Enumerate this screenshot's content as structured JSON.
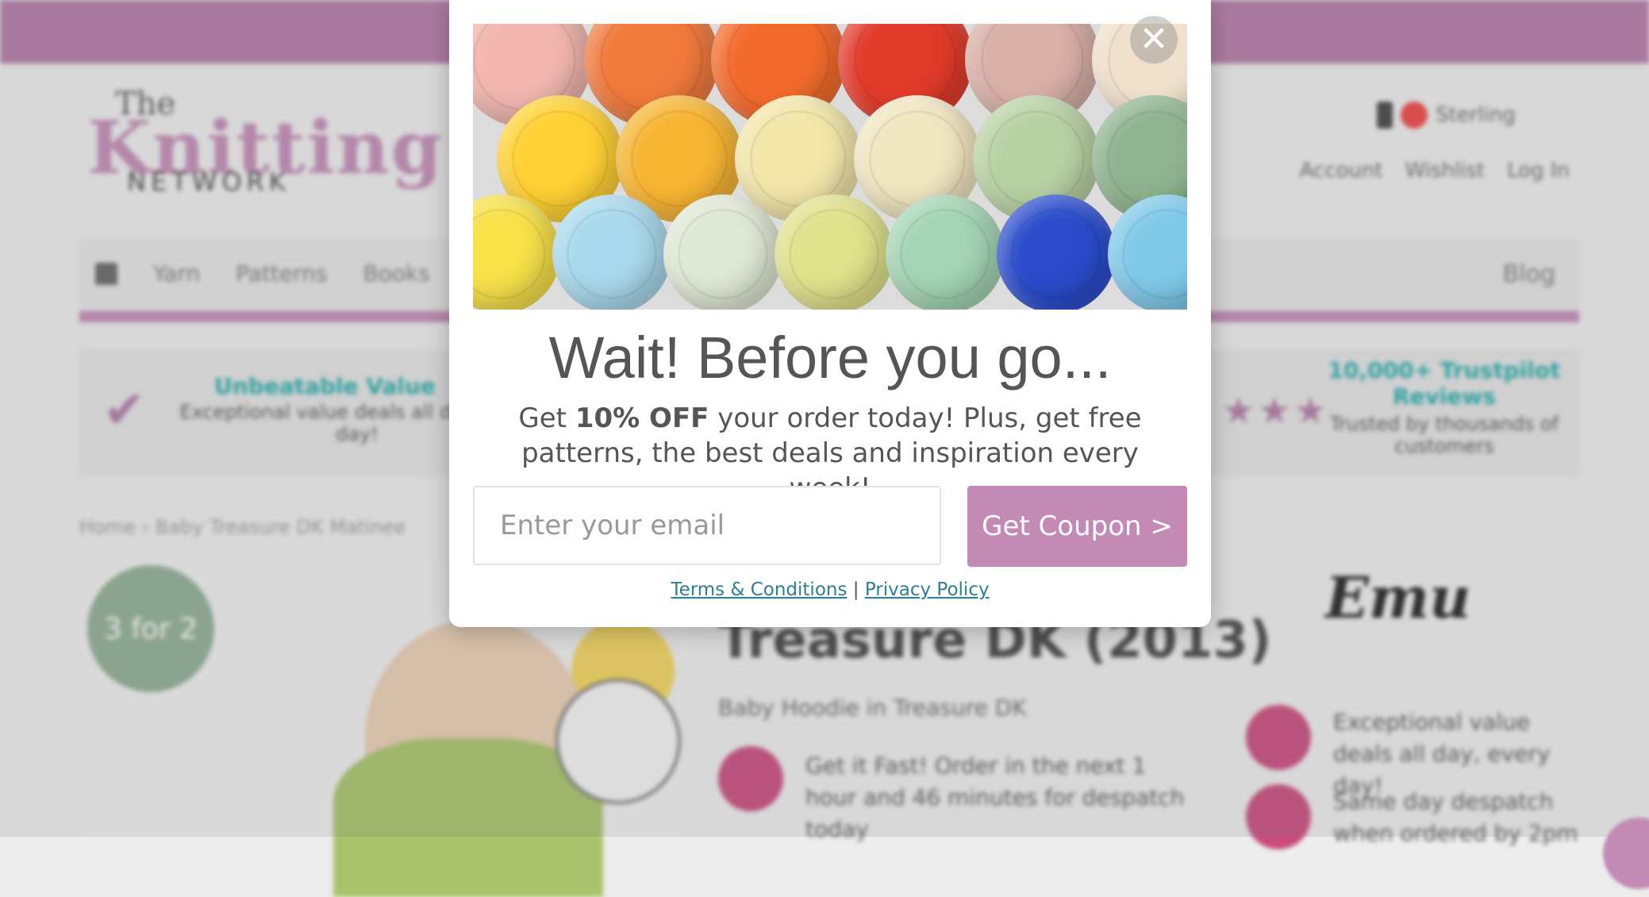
{
  "background_page": {
    "logo": {
      "the": "The",
      "main": "Knitting",
      "sub": "NETWORK"
    },
    "currency_label": "Sterling",
    "account_links": [
      "Account",
      "Wishlist",
      "Log In"
    ],
    "nav_items": [
      "Yarn",
      "Patterns",
      "Books"
    ],
    "nav_right": "Blog",
    "usp_left": {
      "title": "Unbeatable Value",
      "text": "Exceptional value deals all day every day!"
    },
    "usp_right": {
      "title": "10,000+ Trustpilot Reviews",
      "text": "Trusted by thousands of customers"
    },
    "breadcrumb": "Home › Baby Treasure DK Matinee",
    "product_badge": "3 for 2",
    "product_title": "Treasure DK (2013)",
    "product_subtitle": "Baby Hoodie in Treasure DK",
    "dispatch_text": "Get it Fast! Order in the next 1 hour and 46 minutes for despatch today",
    "brand_logo": "Emu",
    "side_usp_1": "Exceptional value deals all day, every day!",
    "side_usp_2": "Same day despatch when ordered by 2pm"
  },
  "modal": {
    "close_label": "✕",
    "headline": "Wait! Before you go...",
    "subtext_prefix": "Get ",
    "subtext_bold": "10% OFF",
    "subtext_suffix": " your order today! Plus, get free patterns, the best deals and inspiration every week!",
    "email_placeholder": "Enter your email",
    "button_label": "Get Coupon >",
    "terms_label": "Terms & Conditions",
    "separator": "|",
    "privacy_label": "Privacy Policy"
  },
  "colors": {
    "brand": "#c28ab5",
    "topbar": "#b47aa8",
    "link": "#2c7f94",
    "accent_pink": "#c94b7c"
  },
  "hero_image": {
    "subject": "rows of colorful yarn balls",
    "yarn_colors": [
      "#f3b7b0",
      "#f07a3c",
      "#f36b2c",
      "#e23b2a",
      "#d9b0a8",
      "#f0e0cc",
      "#ffd133",
      "#f7b533",
      "#f2e6a9",
      "#f0e6c0",
      "#b8d2a4",
      "#8fb38f",
      "#f7e24a",
      "#a9d9ec",
      "#dfe8d4",
      "#e0e28b",
      "#a4d4b4",
      "#2a4ccc",
      "#7fc9e9",
      "#6aa9e2",
      "#5f8ae0",
      "#3a6ad6",
      "#1e43c8"
    ]
  }
}
